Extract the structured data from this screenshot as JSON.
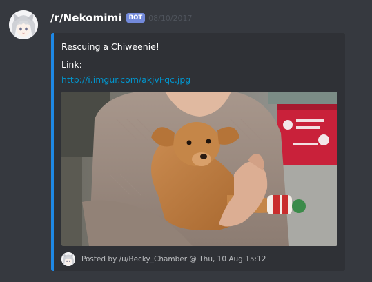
{
  "message": {
    "author": "/r/Nekomimi",
    "bot_badge": "BOT",
    "timestamp": "08/10/2017"
  },
  "embed": {
    "accent_color": "#1e88e5",
    "title": "Rescuing a Chiweenie!",
    "link_label": "Link:",
    "link_url": "http://i.imgur.com/akjvFqc.jpg",
    "image_alt": "Person holding a tan Chiweenie puppy",
    "footer_text": "Posted by /u/Becky_Chamber @ Thu, 10 Aug 15:12"
  }
}
